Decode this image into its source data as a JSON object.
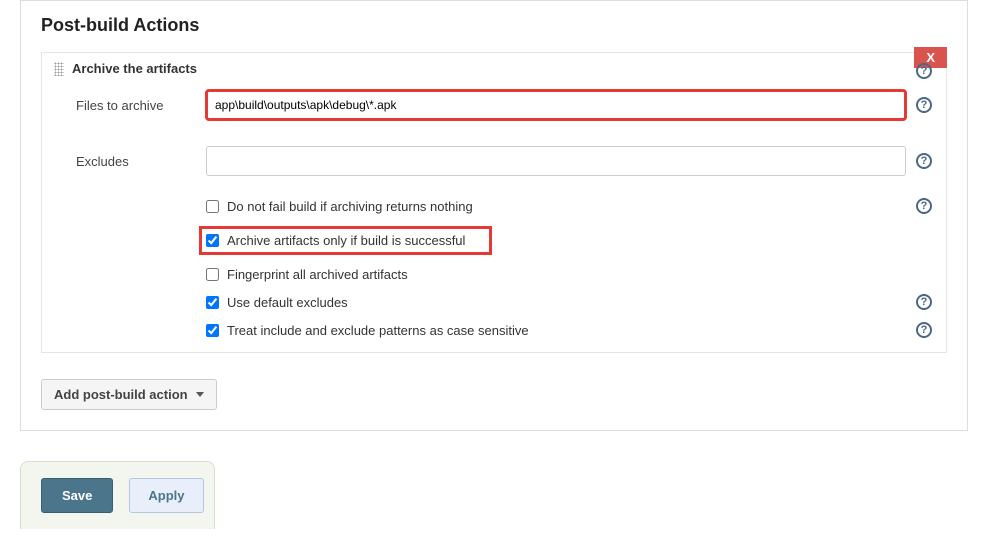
{
  "section": {
    "title": "Post-build Actions"
  },
  "archive": {
    "title": "Archive the artifacts",
    "delete_label": "X",
    "files_label": "Files to archive",
    "files_value": "app\\build\\outputs\\apk\\debug\\*.apk",
    "excludes_label": "Excludes",
    "excludes_value": "",
    "options": {
      "noFail": {
        "label": "Do not fail build if archiving returns nothing",
        "checked": false
      },
      "onlySuccess": {
        "label": "Archive artifacts only if build is successful",
        "checked": true
      },
      "fingerprint": {
        "label": "Fingerprint all archived artifacts",
        "checked": false
      },
      "defaultExcludes": {
        "label": "Use default excludes",
        "checked": true
      },
      "caseSensitive": {
        "label": "Treat include and exclude patterns as case sensitive",
        "checked": true
      }
    }
  },
  "buttons": {
    "addAction": "Add post-build action",
    "save": "Save",
    "apply": "Apply"
  }
}
